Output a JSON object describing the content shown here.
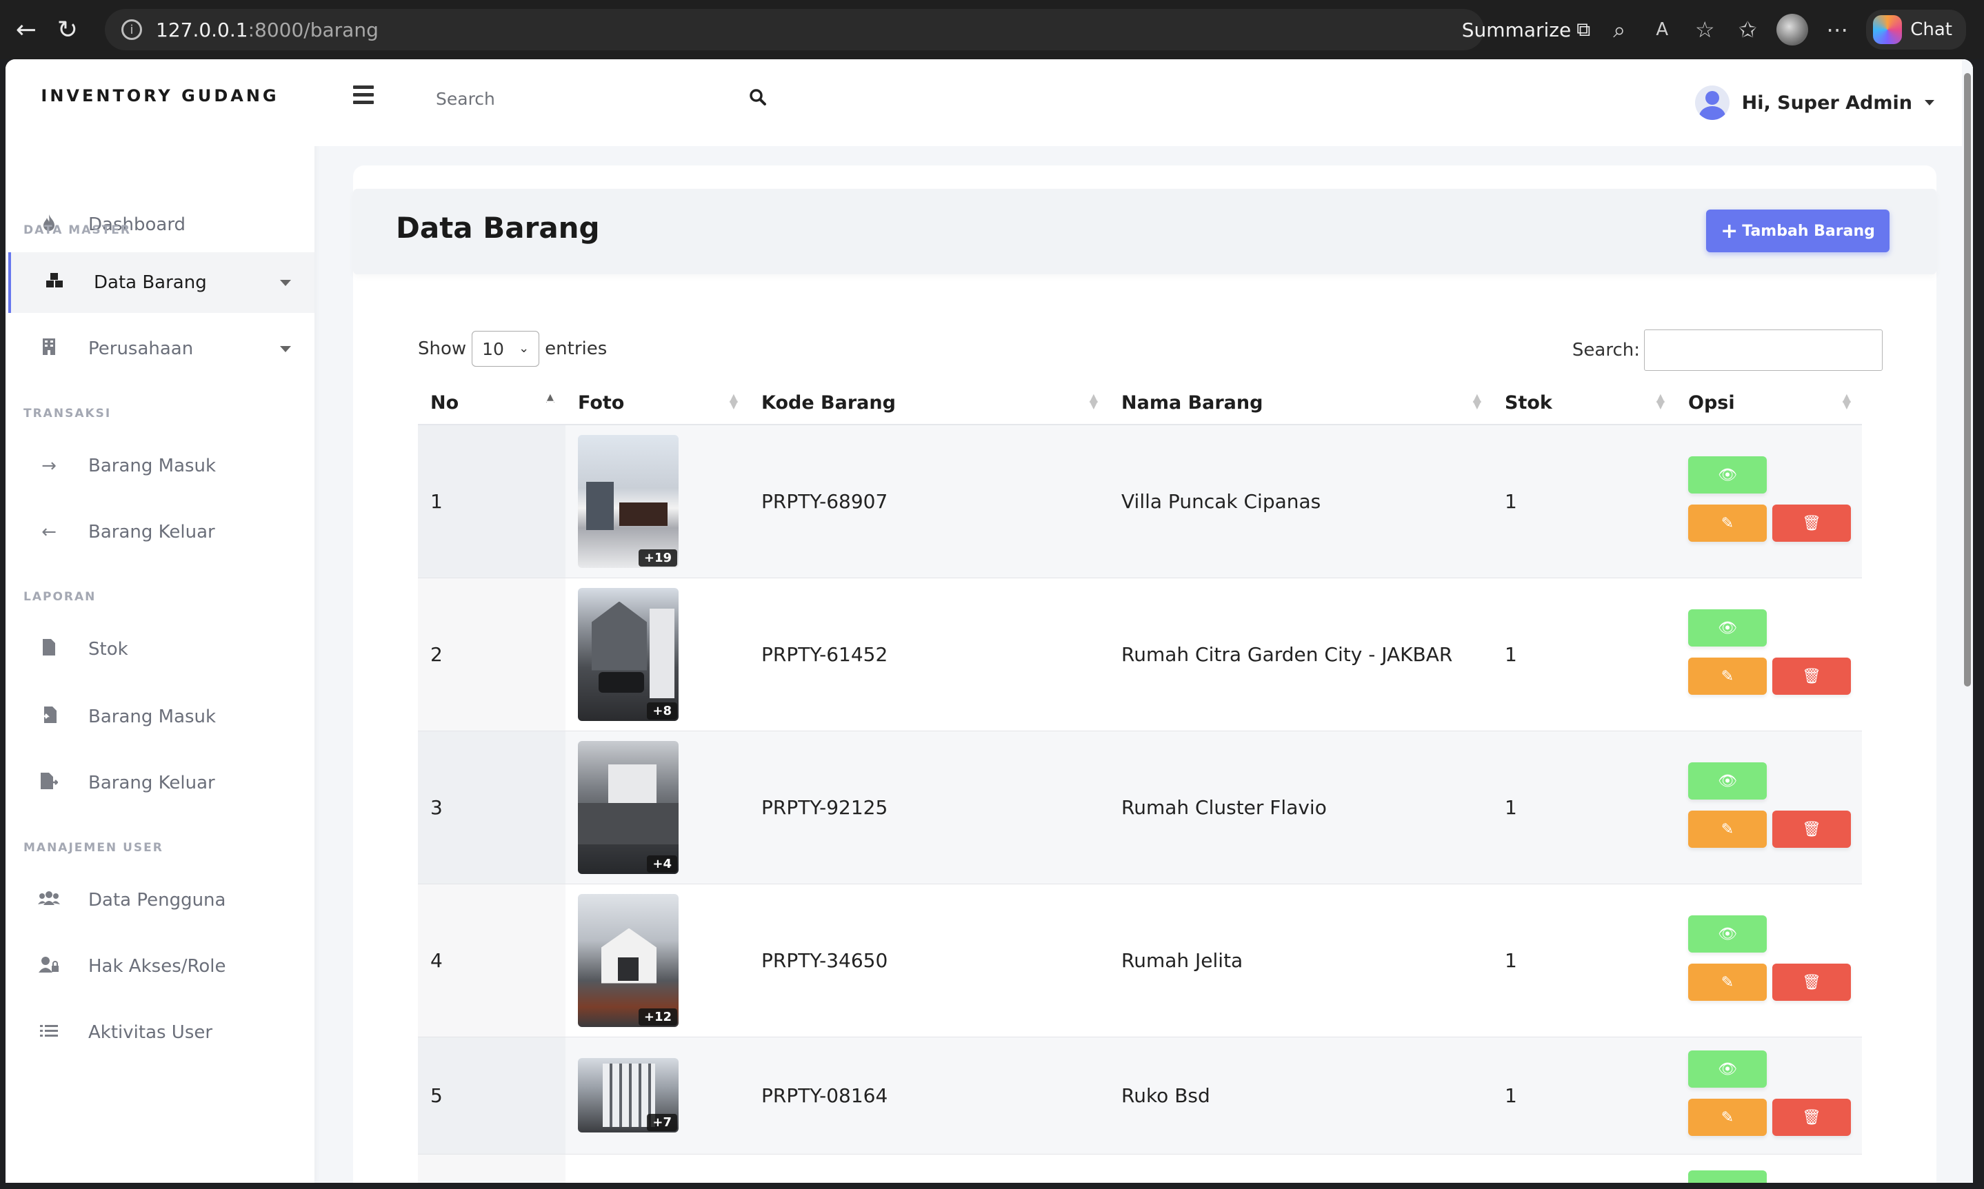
{
  "browser": {
    "url_host": "127.0.0.1",
    "url_path": ":8000/barang",
    "summarize_label": "Summarize",
    "chat_label": "Chat"
  },
  "sidebar": {
    "brand": "INVENTORY GUDANG",
    "dashboard": "Dashboard",
    "header_master": "DATA MASTER",
    "data_barang": "Data Barang",
    "perusahaan": "Perusahaan",
    "header_transaksi": "TRANSAKSI",
    "barang_masuk": "Barang Masuk",
    "barang_keluar": "Barang Keluar",
    "header_laporan": "LAPORAN",
    "stok": "Stok",
    "lap_barang_masuk": "Barang Masuk",
    "lap_barang_keluar": "Barang Keluar",
    "header_user": "MANAJEMEN USER",
    "data_pengguna": "Data Pengguna",
    "hak_akses": "Hak Akses/Role",
    "aktivitas": "Aktivitas User"
  },
  "navbar": {
    "search_placeholder": "Search",
    "user_greeting": "Hi, Super Admin"
  },
  "main": {
    "title": "Data Barang",
    "add_button": "Tambah Barang",
    "show_label": "Show",
    "entries_value": "10",
    "entries_label": "entries",
    "search_label": "Search:"
  },
  "table": {
    "columns": [
      "No",
      "Foto",
      "Kode Barang",
      "Nama Barang",
      "Stok",
      "Opsi"
    ],
    "rows": [
      {
        "no": "1",
        "photo_badge": "+19",
        "kode": "PRPTY-68907",
        "nama": "Villa Puncak Cipanas",
        "stok": "1"
      },
      {
        "no": "2",
        "photo_badge": "+8",
        "kode": "PRPTY-61452",
        "nama": "Rumah Citra Garden City - JAKBAR",
        "stok": "1"
      },
      {
        "no": "3",
        "photo_badge": "+4",
        "kode": "PRPTY-92125",
        "nama": "Rumah Cluster Flavio",
        "stok": "1"
      },
      {
        "no": "4",
        "photo_badge": "+12",
        "kode": "PRPTY-34650",
        "nama": "Rumah Jelita",
        "stok": "1"
      },
      {
        "no": "5",
        "photo_badge": "+7",
        "kode": "PRPTY-08164",
        "nama": "Ruko Bsd",
        "stok": "1"
      }
    ]
  },
  "colors": {
    "primary": "#6777ef",
    "view_button": "#7ee87e",
    "edit_button": "#f6a53c",
    "delete_button": "#ec5a4b"
  },
  "icons": {
    "view": "eye-icon",
    "edit": "edit-icon",
    "delete": "trash-icon"
  }
}
